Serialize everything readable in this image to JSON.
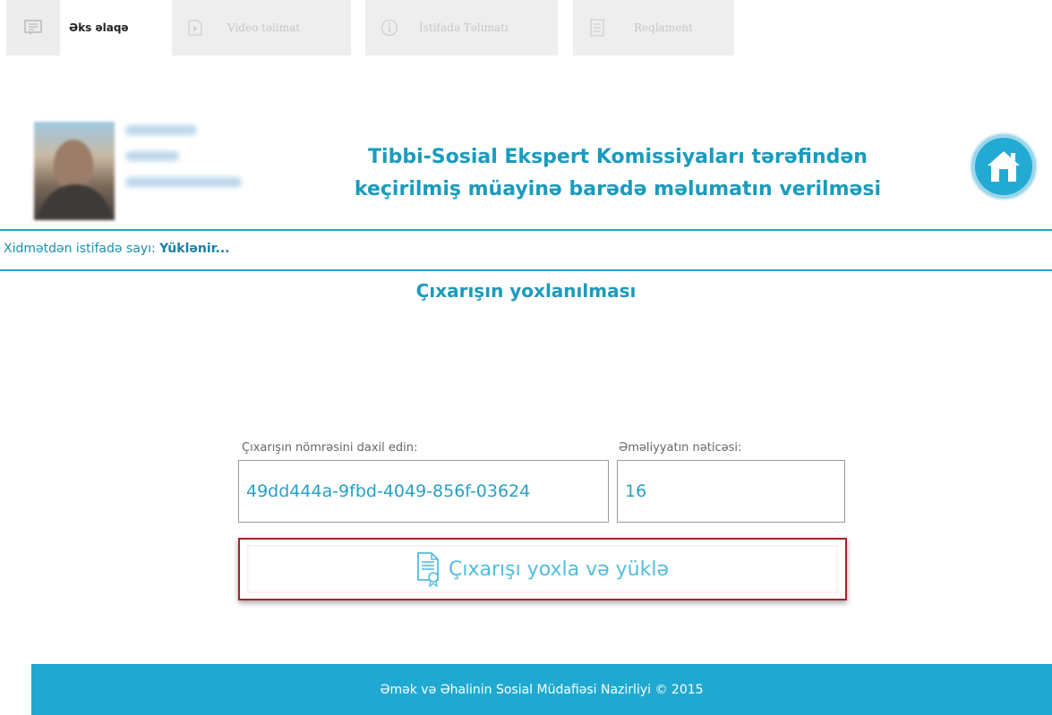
{
  "tabs": [
    {
      "label": "Əks əlaqə",
      "icon": "feedback-icon",
      "active": true
    },
    {
      "label": "Video təlimat",
      "icon": "video-icon",
      "active": false
    },
    {
      "label": "İstifadə Təlimatı",
      "icon": "info-icon",
      "active": false
    },
    {
      "label": "Reqlament",
      "icon": "document-icon",
      "active": false
    }
  ],
  "header": {
    "title_line1": "Tibbi-Sosial Ekspert Komissiyaları tərəfindən",
    "title_line2": "keçirilmiş müayinə barədə məlumatın verilməsi",
    "home_icon": "home-icon"
  },
  "usage": {
    "label": "Xidmətdən istifadə sayı:",
    "value": "Yüklənir..."
  },
  "section_title": "Çıxarışın yoxlanılması",
  "form": {
    "number_label": "Çıxarışın nömrəsini daxil edin:",
    "number_value": "49dd444a-9fbd-4049-856f-03624",
    "result_label": "Əməliyyatın nəticəsi:",
    "result_value": "16",
    "submit_label": "Çıxarışı yoxla və yüklə",
    "submit_icon": "certificate-icon"
  },
  "footer": {
    "text": "Əmək və Əhalinin Sosial Müdafiəsi Nazirliyi © 2015"
  },
  "colors": {
    "accent": "#1fa9d1",
    "highlight_border": "#a4232d"
  }
}
